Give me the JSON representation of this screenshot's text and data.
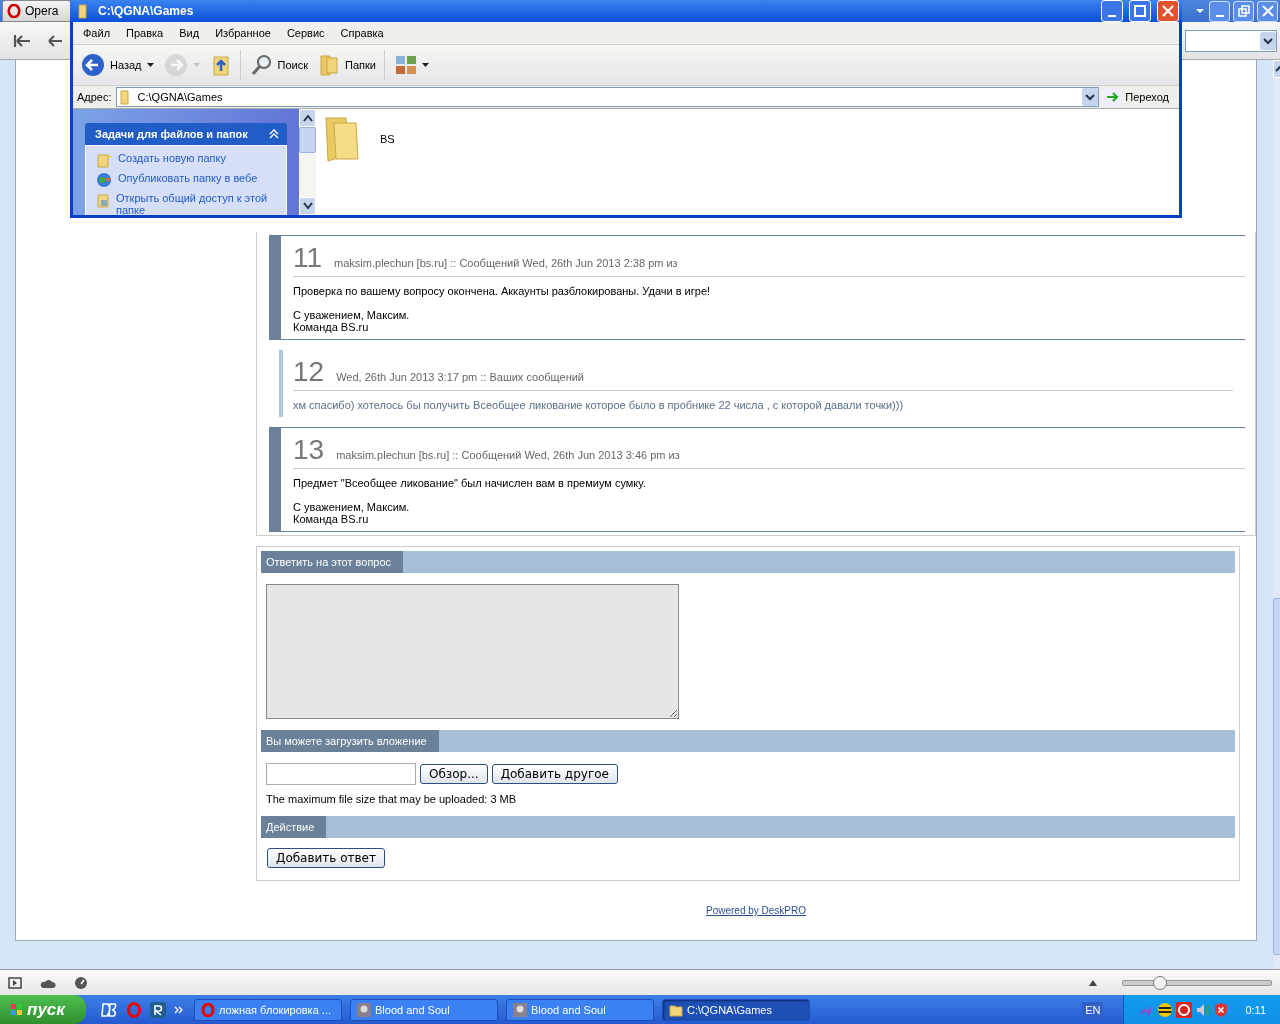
{
  "browser": {
    "tab_label": "Opera",
    "status_bar": {
      "zoom": {
        "level": 0.24
      }
    }
  },
  "explorer": {
    "title": "C:\\QGNA\\Games",
    "menu": [
      "Файл",
      "Правка",
      "Вид",
      "Избранное",
      "Сервис",
      "Справка"
    ],
    "toolbar": [
      {
        "kind": "back",
        "label": "Назад",
        "disabled": false
      },
      {
        "kind": "forward",
        "disabled": true
      },
      {
        "kind": "up"
      },
      {
        "kind": "search",
        "label": "Поиск"
      },
      {
        "kind": "folders",
        "label": "Папки"
      },
      {
        "kind": "views"
      }
    ],
    "address_label": "Адрес:",
    "address": "C:\\QGNA\\Games",
    "go_label": "Переход",
    "tasks_panel": {
      "title": "Задачи для файлов и папок",
      "expanded": true,
      "items": [
        {
          "kind": "new",
          "label": "Создать новую папку"
        },
        {
          "kind": "web",
          "label": "Опубликовать папку в вебе"
        },
        {
          "kind": "share",
          "label": "Открыть общий доступ к этой папке"
        }
      ]
    },
    "files": [
      {
        "name": "BS"
      }
    ]
  },
  "messages": [
    {
      "kind": "staff",
      "number": "11",
      "header": "maksim.plechun [bs.ru] :: Сообщений Wed, 26th Jun 2013 2:38 pm из",
      "paragraphs": [
        [
          "Проверка по вашему вопросу окончена. Аккаунты разблокированы. Удачи в игре!"
        ],
        [
          "С уважением, Максим.",
          "Команда BS.ru"
        ]
      ]
    },
    {
      "kind": "user",
      "number": "12",
      "header": "Wed, 26th Jun 2013 3:17 pm :: Ваших сообщений",
      "paragraphs": [
        [
          "хм спасибо) хотелось бы получить Всеобщее ликование которое было в пробнике 22 числа , с которой давали точки)))"
        ]
      ]
    },
    {
      "kind": "staff",
      "number": "13",
      "header": "maksim.plechun [bs.ru] :: Сообщений Wed, 26th Jun 2013 3:46 pm из",
      "paragraphs": [
        [
          "Предмет \"Всеобщее ликование\" был начислен вам в премиум сумку."
        ],
        [
          "С уважением, Максим.",
          "Команда BS.ru"
        ]
      ]
    }
  ],
  "reply": {
    "title": "Ответить на этот вопрос"
  },
  "attachment": {
    "title": "Вы можете загрузить вложение",
    "browse_label": "Обзор...",
    "add_label": "Добавить другое",
    "note": "The maximum file size that may be uploaded: 3 MB"
  },
  "action": {
    "title": "Действие",
    "submit_label": "Добавить ответ"
  },
  "footer_link": "Powered by DeskPRO",
  "taskbar": {
    "start_label": "пуск",
    "quick_launch": [
      {
        "kind": "db"
      },
      {
        "kind": "opera"
      },
      {
        "kind": "r"
      }
    ],
    "tasks": [
      {
        "kind": "opera",
        "label": "ложная блокировка ...",
        "selected": false
      },
      {
        "kind": "game",
        "label": "Blood and Soul",
        "selected": false
      },
      {
        "kind": "game",
        "label": "Blood and Soul",
        "selected": false
      },
      {
        "kind": "folder",
        "label": "C:\\QGNA\\Games",
        "selected": true
      }
    ],
    "language": "EN",
    "clock": "0:11"
  }
}
